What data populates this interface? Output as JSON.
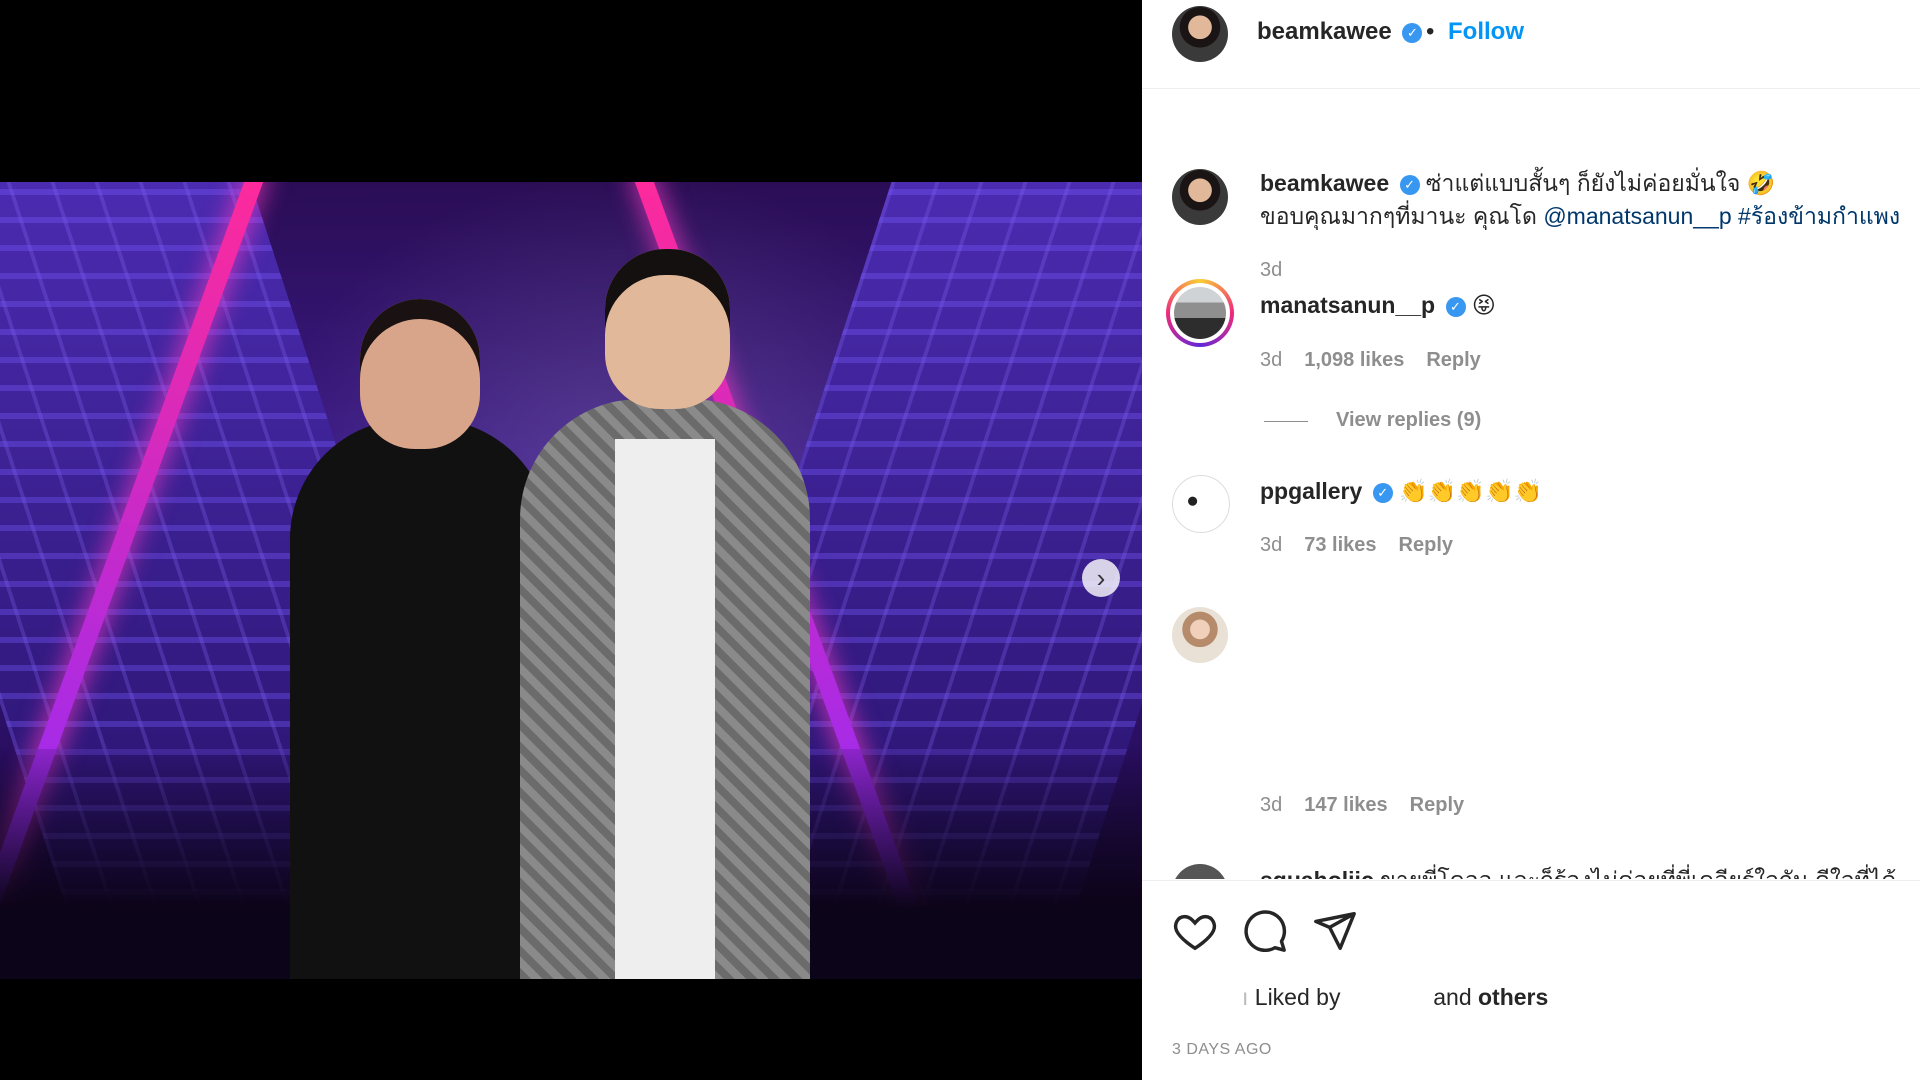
{
  "post": {
    "author": "beamkawee",
    "follow_label": "Follow",
    "separator": "•",
    "verified_mark": "✓",
    "carousel": {
      "slide_count": 4,
      "active_index": 0,
      "next_symbol": "›"
    }
  },
  "caption": {
    "username": "beamkawee",
    "text_line1": "ซ่าแต่แบบสั้นๆ ก็ยังไม่ค่อยมั่นใจ 🤣",
    "text_line2_prefix": "ขอบคุณมากๆที่มานะ คุณโด ",
    "mention": "@manatsanun__p",
    "hashtag": "#ร้องข้ามกำแพง",
    "time": "3d"
  },
  "comments": [
    {
      "username": "manatsanun__p",
      "text": "😝",
      "time": "3d",
      "likes": "1,098 likes",
      "reply_label": "Reply",
      "view_replies": "View replies (9)"
    },
    {
      "username": "ppgallery",
      "text": "👏👏👏👏👏",
      "time": "3d",
      "likes": "73 likes",
      "reply_label": "Reply"
    },
    {
      "username": "",
      "text": "",
      "time": "3d",
      "likes": "147 likes",
      "reply_label": "Reply"
    },
    {
      "username": "squaholiic",
      "text": "ขายพี่โดออ และก็ร้องไม่ค่อยที่พี่เคลียร์ใจกัน ดีใจที่ได้ดู",
      "partial": true
    }
  ],
  "actions": {
    "like_icon": "heart-icon",
    "comment_icon": "comment-icon",
    "share_icon": "paper-plane-icon"
  },
  "likes_summary": {
    "liked_by": "Liked by",
    "and": "and",
    "others": "others"
  },
  "post_date": "3 DAYS AGO",
  "colors": {
    "link": "#00376b",
    "follow": "#0095f6",
    "verified": "#3897f0",
    "muted": "#8e8e8e"
  }
}
